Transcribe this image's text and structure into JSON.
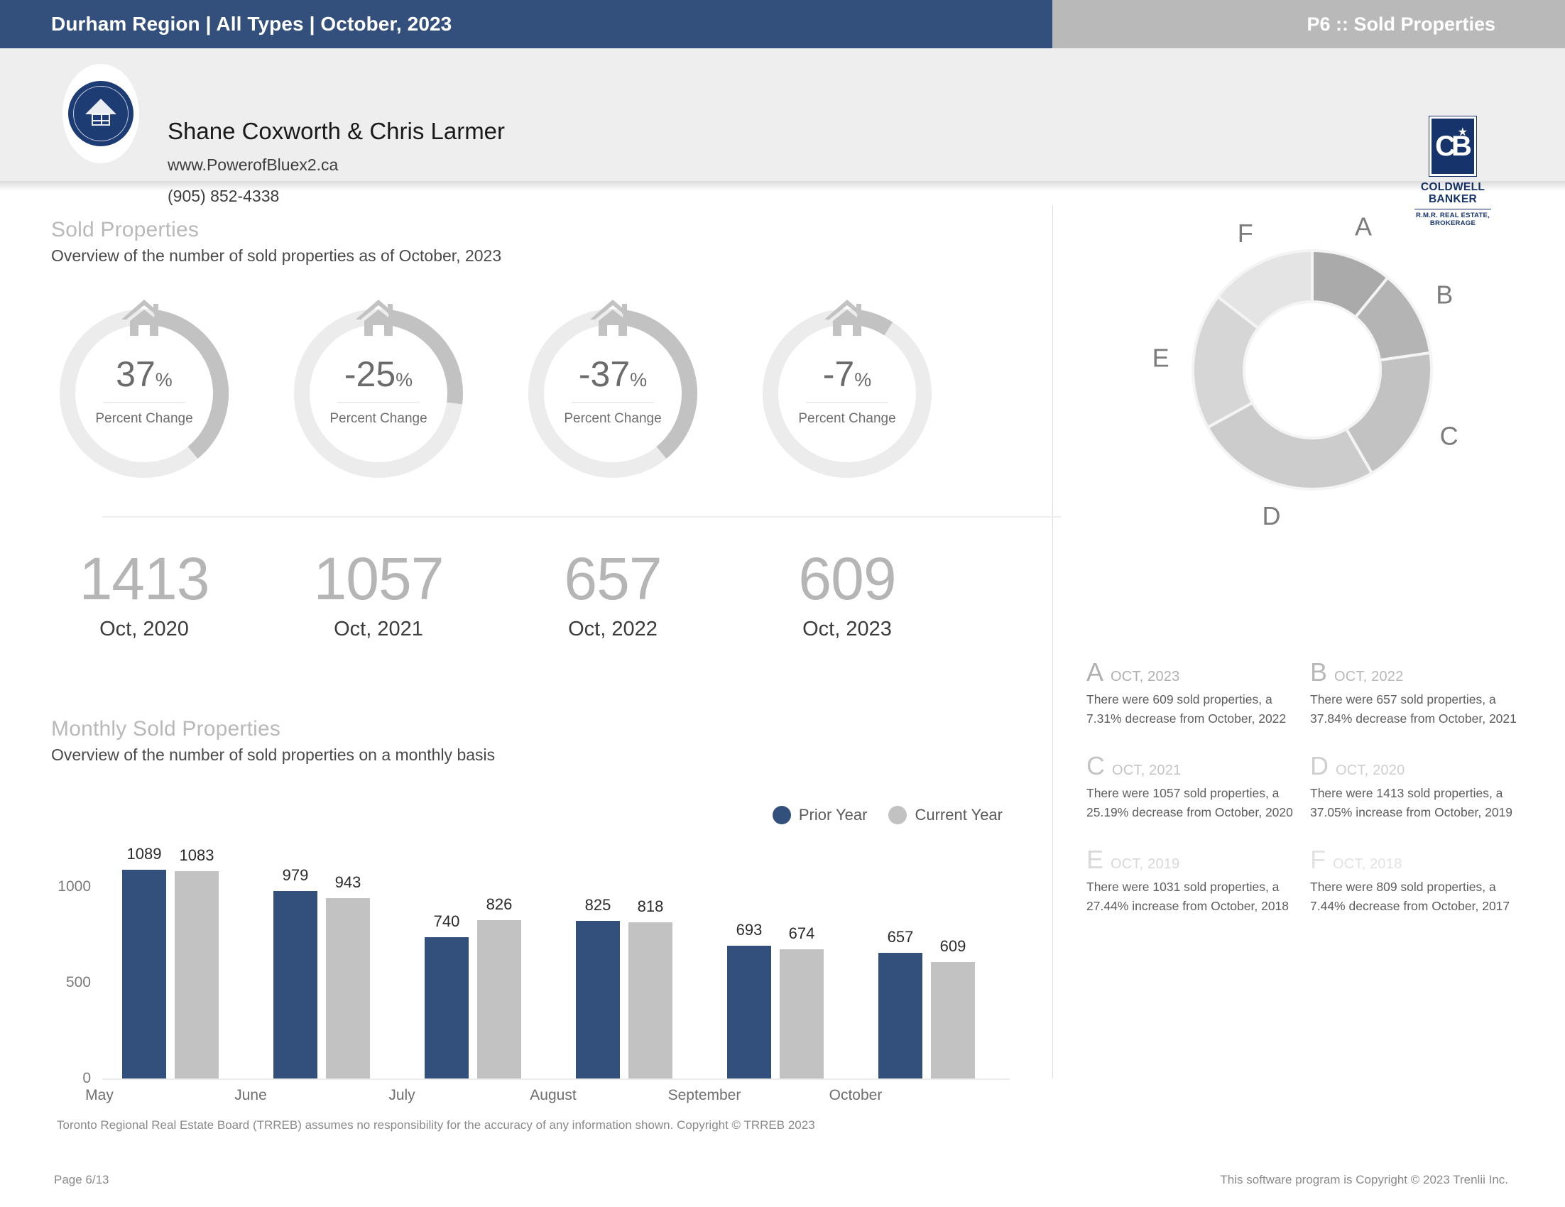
{
  "header": {
    "title": "Durham Region | All Types | October, 2023",
    "page_label": "P6 :: Sold Properties",
    "bar_color": "#33507d",
    "right_bar_color": "#b9b9b9"
  },
  "agent": {
    "name": "Shane Coxworth & Chris Larmer",
    "website": "www.PowerofBluex2.ca",
    "phone": "(905) 852-4338",
    "logo_initials": "CB",
    "brokerage_name_line1": "COLDWELL",
    "brokerage_name_line2": "BANKER",
    "brokerage_sub_line1": "R.M.R. REAL ESTATE,",
    "brokerage_sub_line2": "BROKERAGE"
  },
  "sold_section": {
    "title": "Sold Properties",
    "subtitle": "Overview of the number of sold properties as of October, 2023",
    "gauge_caption": "Percent Change",
    "gauges": [
      {
        "value": "37",
        "symbol": "%",
        "percent": 37,
        "year_total": "1413",
        "year_label": "Oct, 2020"
      },
      {
        "value": "-25",
        "symbol": "%",
        "percent": 25,
        "year_total": "1057",
        "year_label": "Oct, 2021"
      },
      {
        "value": "-37",
        "symbol": "%",
        "percent": 37,
        "year_total": "657",
        "year_label": "Oct, 2022"
      },
      {
        "value": "-7",
        "symbol": "%",
        "percent": 7,
        "year_total": "609",
        "year_label": "Oct, 2023"
      }
    ]
  },
  "monthly_section": {
    "title": "Monthly Sold Properties",
    "subtitle": "Overview of the number of sold properties on a monthly basis",
    "legend": [
      {
        "label": "Prior Year",
        "color": "#33507d"
      },
      {
        "label": "Current Year",
        "color": "#c2c2c2"
      }
    ]
  },
  "chart_data": {
    "type": "bar",
    "title": "Monthly Sold Properties",
    "categories": [
      "May",
      "June",
      "July",
      "August",
      "September",
      "October"
    ],
    "series": [
      {
        "name": "Prior Year",
        "color": "#33507d",
        "values": [
          1089,
          979,
          740,
          825,
          693,
          657
        ]
      },
      {
        "name": "Current Year",
        "color": "#c2c2c2",
        "values": [
          1083,
          943,
          826,
          818,
          674,
          609
        ]
      }
    ],
    "xlabel": "",
    "ylabel": "",
    "yticks": [
      0,
      500,
      1000
    ],
    "ylim": [
      0,
      1150
    ],
    "grid": false,
    "legend_position": "top-right"
  },
  "donut": {
    "type": "pie",
    "labels": [
      "A",
      "B",
      "C",
      "D",
      "E",
      "F"
    ],
    "categories": [
      "OCT, 2023",
      "OCT, 2022",
      "OCT, 2021",
      "OCT, 2020",
      "OCT, 2019",
      "OCT, 2018"
    ],
    "values": [
      609,
      657,
      1057,
      1413,
      1031,
      809
    ],
    "colors": [
      "#aaaaaa",
      "#b4b4b4",
      "#c2c2c2",
      "#cccccc",
      "#d6d6d6",
      "#e4e4e4"
    ]
  },
  "cards": [
    {
      "letter": "A",
      "month": "OCT, 2023",
      "text": "There were 609 sold properties, a 7.31% decrease from October, 2022",
      "letter_color": "#b0b0b0",
      "month_color": "#b0b0b0"
    },
    {
      "letter": "B",
      "month": "OCT, 2022",
      "text": "There were 657 sold properties, a 37.84% decrease from October, 2021",
      "letter_color": "#b8b8b8",
      "month_color": "#b8b8b8"
    },
    {
      "letter": "C",
      "month": "OCT, 2021",
      "text": "There were 1057 sold properties, a 25.19% decrease from October, 2020",
      "letter_color": "#c4c4c4",
      "month_color": "#c4c4c4"
    },
    {
      "letter": "D",
      "month": "OCT, 2020",
      "text": "There were 1413 sold properties, a 37.05% increase from October, 2019",
      "letter_color": "#cfcfcf",
      "month_color": "#cfcfcf"
    },
    {
      "letter": "E",
      "month": "OCT, 2019",
      "text": "There were 1031 sold properties, a 27.44% increase from October, 2018",
      "letter_color": "#d8d8d8",
      "month_color": "#d8d8d8"
    },
    {
      "letter": "F",
      "month": "OCT, 2018",
      "text": "There were 809 sold properties, a 7.44% decrease from October, 2017",
      "letter_color": "#e2e2e2",
      "month_color": "#e2e2e2"
    }
  ],
  "footer": {
    "disclaimer": "Toronto Regional Real Estate Board (TRREB) assumes no responsibility for the accuracy of any information shown. Copyright © TRREB 2023",
    "page": "Page 6/13",
    "software": "This software program is Copyright © 2023 Trenlii Inc."
  }
}
